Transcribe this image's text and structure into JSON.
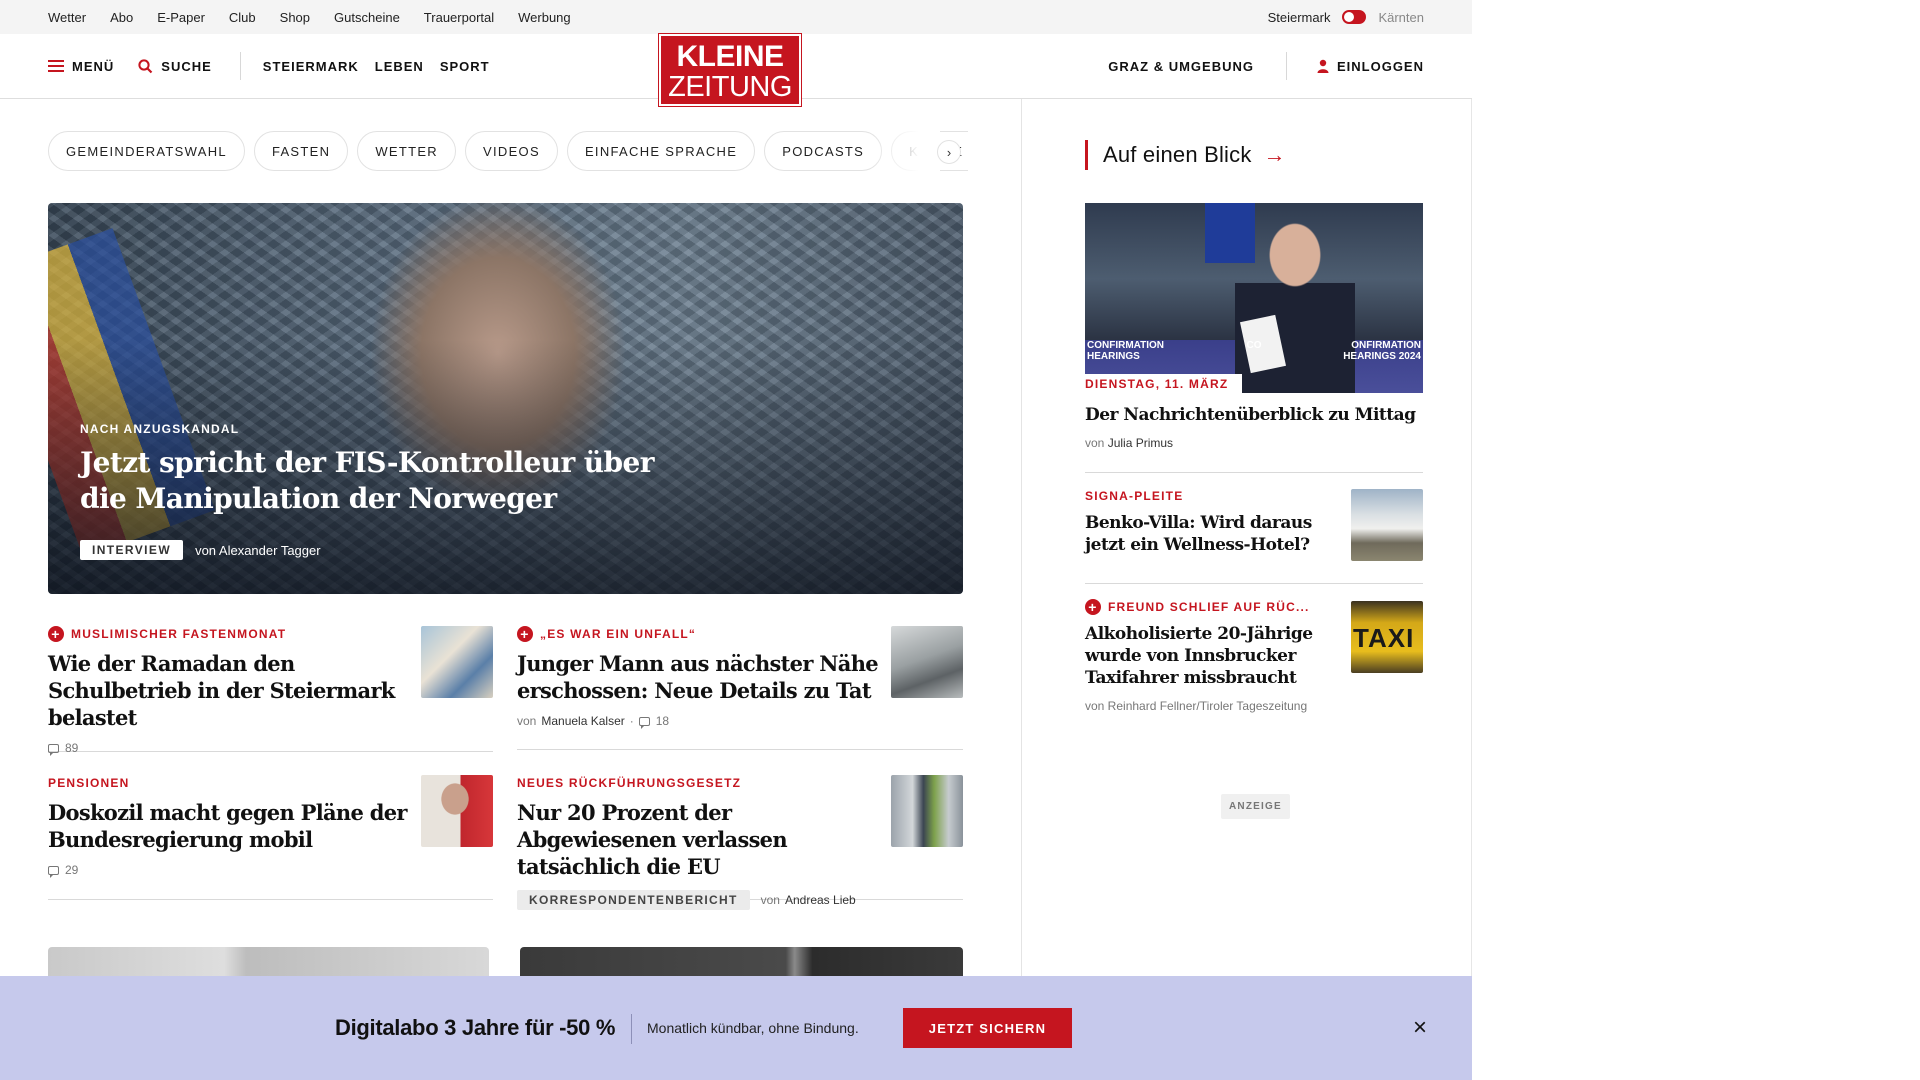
{
  "utility": {
    "links": [
      "Wetter",
      "Abo",
      "E-Paper",
      "Club",
      "Shop",
      "Gutscheine",
      "Trauerportal",
      "Werbung"
    ],
    "region_active": "Steiermark",
    "region_inactive": "Kärnten"
  },
  "nav": {
    "menu": "MENÜ",
    "search": "SUCHE",
    "sections": [
      "STEIERMARK",
      "LEBEN",
      "SPORT"
    ],
    "local": "GRAZ & UMGEBUNG",
    "login": "EINLOGGEN",
    "logo_line1": "KLEINE",
    "logo_line2": "ZEITUNG"
  },
  "chips": [
    "GEMEINDERATSWAHL",
    "FASTEN",
    "WETTER",
    "VIDEOS",
    "EINFACHE SPRACHE",
    "PODCASTS",
    "KLEINE KINDE"
  ],
  "chips_next": "›",
  "hero": {
    "kicker": "NACH ANZUGSKANDAL",
    "title": "Jetzt spricht der FIS-Kontrolleur über die Manipulation der Norweger",
    "badge": "INTERVIEW",
    "byline": "von Alexander Tagger"
  },
  "articles": [
    {
      "kicker": "MUSLIMISCHER FASTENMONAT",
      "premium": true,
      "title": "Wie der Ramadan den Schulbetrieb in der Steiermark belastet",
      "comments": "89"
    },
    {
      "kicker": "„ES WAR EIN UNFALL“",
      "premium": true,
      "title": "Junger Mann aus nächster Nähe erschossen: Neue Details zu Tat",
      "by": "von",
      "author": "Manuela Kalser",
      "comments": "18"
    },
    {
      "kicker": "PENSIONEN",
      "premium": false,
      "title": "Doskozil macht gegen Pläne der Bundesregierung mobil",
      "comments": "29"
    },
    {
      "kicker": "NEUES RÜCKFÜHRUNGSGESETZ",
      "premium": false,
      "title": "Nur 20 Prozent der Abgewiesenen verlassen tatsächlich die EU",
      "badge": "KORRESPONDENTENBERICHT",
      "by": "von",
      "author": "Andreas Lieb"
    }
  ],
  "sidebar": {
    "title": "Auf einen Blick",
    "arrow": "→",
    "hero_band_left": "CONFIRMATION HEARINGS",
    "hero_band_mid": "CO",
    "hero_band_right": "ONFIRMATION HEARINGS 2024",
    "date": "DIENSTAG, 11. MÄRZ",
    "items": [
      {
        "title": "Der Nachrichtenüberblick zu Mittag",
        "by": "von",
        "author": "Julia Primus"
      },
      {
        "kicker": "SIGNA-PLEITE",
        "title": "Benko-Villa: Wird daraus jetzt ein Wellness-Hotel?"
      },
      {
        "kicker": "FREUND SCHLIEF AUF RÜC...",
        "premium": true,
        "title": "Alkoholisierte 20-Jährige wurde von Innsbrucker Taxifahrer missbraucht",
        "byline": "von Reinhard Fellner/Tiroler Tageszeitung"
      }
    ],
    "taxi_text": "TAXI",
    "ad": "ANZEIGE"
  },
  "promo": {
    "headline": "Digitalabo 3 Jahre für -50 %",
    "sub": "Monatlich kündbar, ohne Bindung.",
    "cta": "JETZT SICHERN",
    "close": "×"
  },
  "colors": {
    "brand": "#c5151f",
    "promo_bg": "#c6c9ec"
  }
}
